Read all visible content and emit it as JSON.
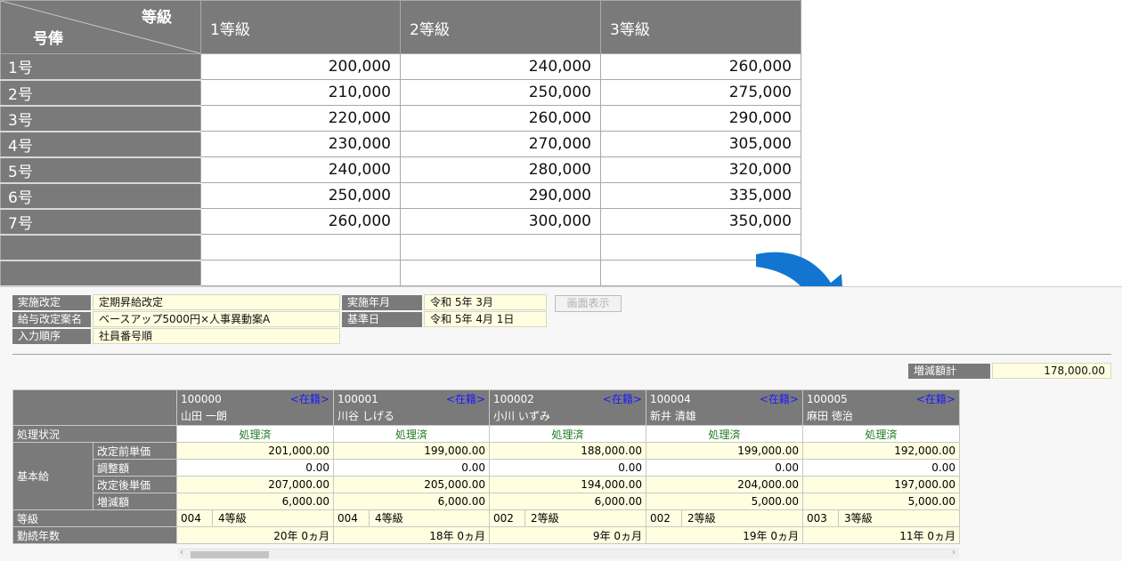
{
  "grade_table": {
    "corner_top": "等級",
    "corner_bottom": "号俸",
    "grades": [
      "1等級",
      "2等級",
      "3等級"
    ],
    "rows": [
      {
        "label": "1号",
        "values": [
          "200,000",
          "240,000",
          "260,000"
        ]
      },
      {
        "label": "2号",
        "values": [
          "210,000",
          "250,000",
          "275,000"
        ]
      },
      {
        "label": "3号",
        "values": [
          "220,000",
          "260,000",
          "290,000"
        ]
      },
      {
        "label": "4号",
        "values": [
          "230,000",
          "270,000",
          "305,000"
        ]
      },
      {
        "label": "5号",
        "values": [
          "240,000",
          "280,000",
          "320,000"
        ]
      },
      {
        "label": "6号",
        "values": [
          "250,000",
          "290,000",
          "335,000"
        ]
      },
      {
        "label": "7号",
        "values": [
          "260,000",
          "300,000",
          "350,000"
        ]
      },
      {
        "label": "",
        "values": [
          "",
          "",
          ""
        ]
      },
      {
        "label": "",
        "values": [
          "",
          "",
          ""
        ]
      }
    ]
  },
  "header": {
    "implementation_label": "実施改定",
    "implementation_value": "定期昇給改定",
    "plan_label": "給与改定案名",
    "plan_value": "ベースアップ5000円×人事異動案A",
    "order_label": "入力順序",
    "order_value": "社員番号順",
    "year_label": "実施年月",
    "year_value": "令和  5年  3月",
    "base_date_label": "基準日",
    "base_date_value": "令和  5年  4月  1日",
    "show_button": "画面表示",
    "total_label": "増減額計",
    "total_value": "178,000.00"
  },
  "row_labels": {
    "status": "処理状況",
    "base_salary": "基本給",
    "before": "改定前単価",
    "adjust": "調整額",
    "after": "改定後単価",
    "diff": "増減額",
    "grade": "等級",
    "years": "勤続年数"
  },
  "employees": [
    {
      "id": "100000",
      "status_tag": "<在籍>",
      "name": "山田  一朗",
      "status": "処理済",
      "before": "201,000.00",
      "adjust": "0.00",
      "after": "207,000.00",
      "diff": "6,000.00",
      "grade_code": "004",
      "grade_name": "4等級",
      "years": "20年 0ヵ月"
    },
    {
      "id": "100001",
      "status_tag": "<在籍>",
      "name": "川谷  しげる",
      "status": "処理済",
      "before": "199,000.00",
      "adjust": "0.00",
      "after": "205,000.00",
      "diff": "6,000.00",
      "grade_code": "004",
      "grade_name": "4等級",
      "years": "18年 0ヵ月"
    },
    {
      "id": "100002",
      "status_tag": "<在籍>",
      "name": "小川  いずみ",
      "status": "処理済",
      "before": "188,000.00",
      "adjust": "0.00",
      "after": "194,000.00",
      "diff": "6,000.00",
      "grade_code": "002",
      "grade_name": "2等級",
      "years": "9年 0ヵ月"
    },
    {
      "id": "100004",
      "status_tag": "<在籍>",
      "name": "新井  清雄",
      "status": "処理済",
      "before": "199,000.00",
      "adjust": "0.00",
      "after": "204,000.00",
      "diff": "5,000.00",
      "grade_code": "002",
      "grade_name": "2等級",
      "years": "19年 0ヵ月"
    },
    {
      "id": "100005",
      "status_tag": "<在籍>",
      "name": "麻田  徳治",
      "status": "処理済",
      "before": "192,000.00",
      "adjust": "0.00",
      "after": "197,000.00",
      "diff": "5,000.00",
      "grade_code": "003",
      "grade_name": "3等級",
      "years": "11年 0ヵ月"
    }
  ],
  "icons": {
    "arrow": "curved-arrow-icon",
    "scroll_left": "chevron-left-icon",
    "scroll_right": "chevron-right-icon"
  },
  "colors": {
    "header_gray": "#7a7a7a",
    "input_yellow": "#fffee0",
    "status_green": "#1f7a1f",
    "tag_blue": "#1a1aff",
    "arrow_blue": "#1276d0"
  }
}
